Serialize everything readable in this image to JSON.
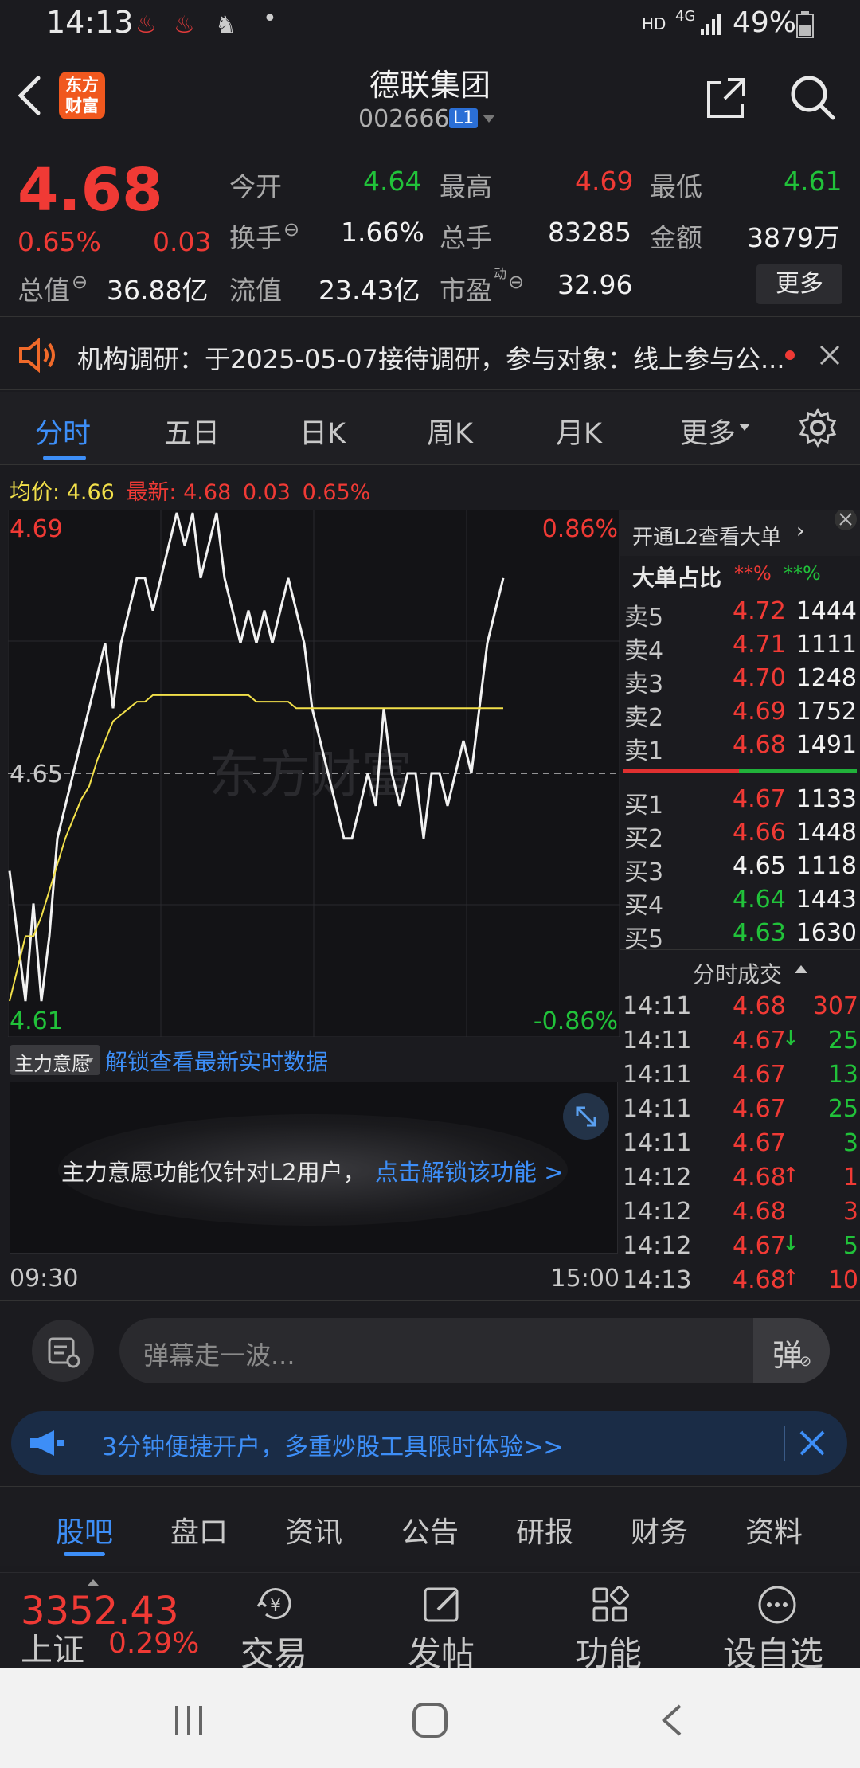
{
  "status": {
    "time": "14:13",
    "hd": "HD",
    "net": "4G",
    "battery": "49%"
  },
  "header": {
    "logo_line1": "东方",
    "logo_line2": "财富",
    "title": "德联集团",
    "code": "002666",
    "level": "L1"
  },
  "quote": {
    "price": "4.68",
    "change_pct": "0.65%",
    "change": "0.03",
    "open_label": "今开",
    "open": "4.64",
    "high_label": "最高",
    "high": "4.69",
    "low_label": "最低",
    "low": "4.61",
    "turnover_label": "换手",
    "turnover": "1.66%",
    "volume_label": "总手",
    "volume": "83285",
    "amount_label": "金额",
    "amount": "3879万",
    "mktcap_label": "总值",
    "mktcap": "36.88亿",
    "float_label": "流值",
    "float": "23.43亿",
    "pe_label": "市盈",
    "pe_sup": "动",
    "pe": "32.96",
    "more": "更多"
  },
  "notice": {
    "text": "机构调研：于2025-05-07接待调研，参与对象：线上参与公..."
  },
  "tabs": [
    "分时",
    "五日",
    "日K",
    "周K",
    "月K",
    "更多"
  ],
  "avg_line": {
    "avg_label": "均价:",
    "avg": "4.66",
    "latest_label": "最新:",
    "latest": "4.68",
    "chg": "0.03",
    "pct": "0.65%"
  },
  "chart_data": {
    "type": "line",
    "y_top_label": "4.69",
    "y_mid_label": "4.65",
    "y_bottom_label": "4.61",
    "pct_top_label": "0.86%",
    "pct_bottom_label": "-0.86%",
    "ylim": [
      4.61,
      4.69
    ],
    "reference": 4.65,
    "watermark": "东方财富",
    "x_start": "09:30",
    "x_end": "15:00",
    "series": [
      {
        "name": "价格",
        "color": "#f2f2f2",
        "values": [
          4.635,
          4.625,
          4.615,
          4.63,
          4.615,
          4.625,
          4.64,
          4.645,
          4.65,
          4.655,
          4.66,
          4.665,
          4.67,
          4.66,
          4.67,
          4.675,
          4.68,
          4.68,
          4.675,
          4.68,
          4.685,
          4.69,
          4.685,
          4.69,
          4.68,
          4.685,
          4.69,
          4.68,
          4.675,
          4.67,
          4.675,
          4.67,
          4.675,
          4.67,
          4.675,
          4.68,
          4.675,
          4.67,
          4.66,
          4.655,
          4.65,
          4.645,
          4.64,
          4.64,
          4.645,
          4.65,
          4.645,
          4.66,
          4.65,
          4.645,
          4.65,
          4.65,
          4.64,
          4.65,
          4.65,
          4.645,
          4.65,
          4.655,
          4.65,
          4.66,
          4.67,
          4.675,
          4.68
        ]
      },
      {
        "name": "均价",
        "color": "#f2e04a",
        "values": [
          4.615,
          4.62,
          4.625,
          4.625,
          4.628,
          4.632,
          4.636,
          4.64,
          4.643,
          4.646,
          4.648,
          4.652,
          4.655,
          4.658,
          4.659,
          4.66,
          4.661,
          4.661,
          4.662,
          4.662,
          4.662,
          4.662,
          4.662,
          4.662,
          4.662,
          4.662,
          4.662,
          4.662,
          4.662,
          4.662,
          4.662,
          4.661,
          4.661,
          4.661,
          4.661,
          4.661,
          4.66,
          4.66,
          4.66,
          4.66,
          4.66,
          4.66,
          4.66,
          4.66,
          4.66,
          4.66,
          4.66,
          4.66,
          4.66,
          4.66,
          4.66,
          4.66,
          4.66,
          4.66,
          4.66,
          4.66,
          4.66,
          4.66,
          4.66,
          4.66,
          4.66,
          4.66,
          4.66
        ]
      }
    ]
  },
  "depth": {
    "l2_link": "开通L2查看大单",
    "big_ratio_label": "大单占比",
    "big_ratio_red": "**%",
    "big_ratio_green": "**%",
    "sells": [
      {
        "label": "卖5",
        "price": "4.72",
        "vol": "1444",
        "color": "red"
      },
      {
        "label": "卖4",
        "price": "4.71",
        "vol": "1111",
        "color": "red"
      },
      {
        "label": "卖3",
        "price": "4.70",
        "vol": "1248",
        "color": "red"
      },
      {
        "label": "卖2",
        "price": "4.69",
        "vol": "1752",
        "color": "red"
      },
      {
        "label": "卖1",
        "price": "4.68",
        "vol": "1491",
        "color": "red"
      }
    ],
    "buys": [
      {
        "label": "买1",
        "price": "4.67",
        "vol": "1133",
        "color": "red"
      },
      {
        "label": "买2",
        "price": "4.66",
        "vol": "1448",
        "color": "red"
      },
      {
        "label": "买3",
        "price": "4.65",
        "vol": "1118",
        "color": "white"
      },
      {
        "label": "买4",
        "price": "4.64",
        "vol": "1443",
        "color": "green"
      },
      {
        "label": "买5",
        "price": "4.63",
        "vol": "1630",
        "color": "green"
      }
    ],
    "ticks_title": "分时成交",
    "ticks": [
      {
        "time": "14:11",
        "price": "4.68",
        "arrow": "",
        "vol": "307",
        "vcolor": "red"
      },
      {
        "time": "14:11",
        "price": "4.67",
        "arrow": "↓",
        "vol": "25",
        "vcolor": "green"
      },
      {
        "time": "14:11",
        "price": "4.67",
        "arrow": "",
        "vol": "13",
        "vcolor": "green"
      },
      {
        "time": "14:11",
        "price": "4.67",
        "arrow": "",
        "vol": "25",
        "vcolor": "green"
      },
      {
        "time": "14:11",
        "price": "4.67",
        "arrow": "",
        "vol": "3",
        "vcolor": "green"
      },
      {
        "time": "14:12",
        "price": "4.68",
        "arrow": "↑",
        "vol": "1",
        "vcolor": "red"
      },
      {
        "time": "14:12",
        "price": "4.68",
        "arrow": "",
        "vol": "3",
        "vcolor": "red"
      },
      {
        "time": "14:12",
        "price": "4.67",
        "arrow": "↓",
        "vol": "5",
        "vcolor": "green"
      },
      {
        "time": "14:13",
        "price": "4.68",
        "arrow": "↑",
        "vol": "10",
        "vcolor": "red"
      }
    ]
  },
  "intent": {
    "dropdown": "主力意愿",
    "unlock_link": "解锁查看最新实时数据",
    "message": "主力意愿功能仅针对L2用户，",
    "message_link": "点击解锁该功能 >"
  },
  "danmu": {
    "placeholder": "弹幕走一波...",
    "button": "弹"
  },
  "promo": {
    "text": "3分钟便捷开户，多重炒股工具限时体验>>"
  },
  "bottom_tabs": [
    "股吧",
    "盘口",
    "资讯",
    "公告",
    "研报",
    "财务",
    "资料"
  ],
  "toolbar": {
    "index_value": "3352.43",
    "index_name": "上证",
    "index_pct": "0.29%",
    "trade": "交易",
    "post": "发帖",
    "func": "功能",
    "watch": "设自选"
  },
  "colors": {
    "up": "#f03a35",
    "down": "#21c23a",
    "accent": "#3d8ef7",
    "bg": "#1b1b1f"
  }
}
